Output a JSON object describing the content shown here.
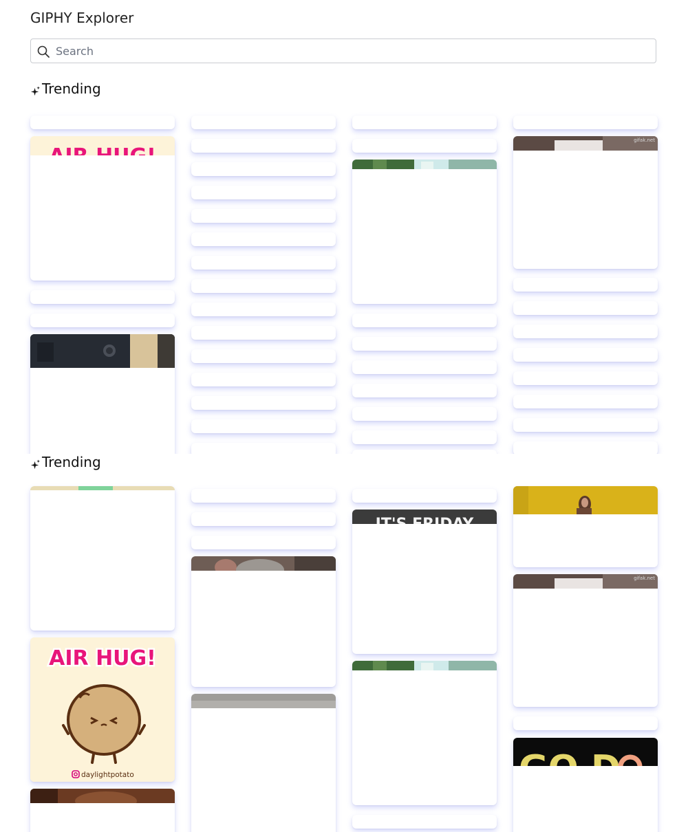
{
  "app": {
    "title": "GIPHY Explorer"
  },
  "search": {
    "placeholder": "Search",
    "value": ""
  },
  "sections": [
    {
      "title": "Trending",
      "icon": "sparkles-icon"
    },
    {
      "title": "Trending",
      "icon": "sparkles-icon"
    }
  ],
  "gifs": {
    "air_hug_text": "AIR HUG!",
    "air_hug_credit": "daylightpotato",
    "friday_text": "IT'S FRIDAY",
    "watermark": "gifak.net",
    "good_text": "GO D"
  },
  "colors": {
    "card_shadow": "#6c78f0",
    "air_hug_pink": "#e8157a",
    "air_hug_bg": "#fdf3d9",
    "friday_bg": "#3b3b3b",
    "yellow_bg": "#d9b21a"
  }
}
